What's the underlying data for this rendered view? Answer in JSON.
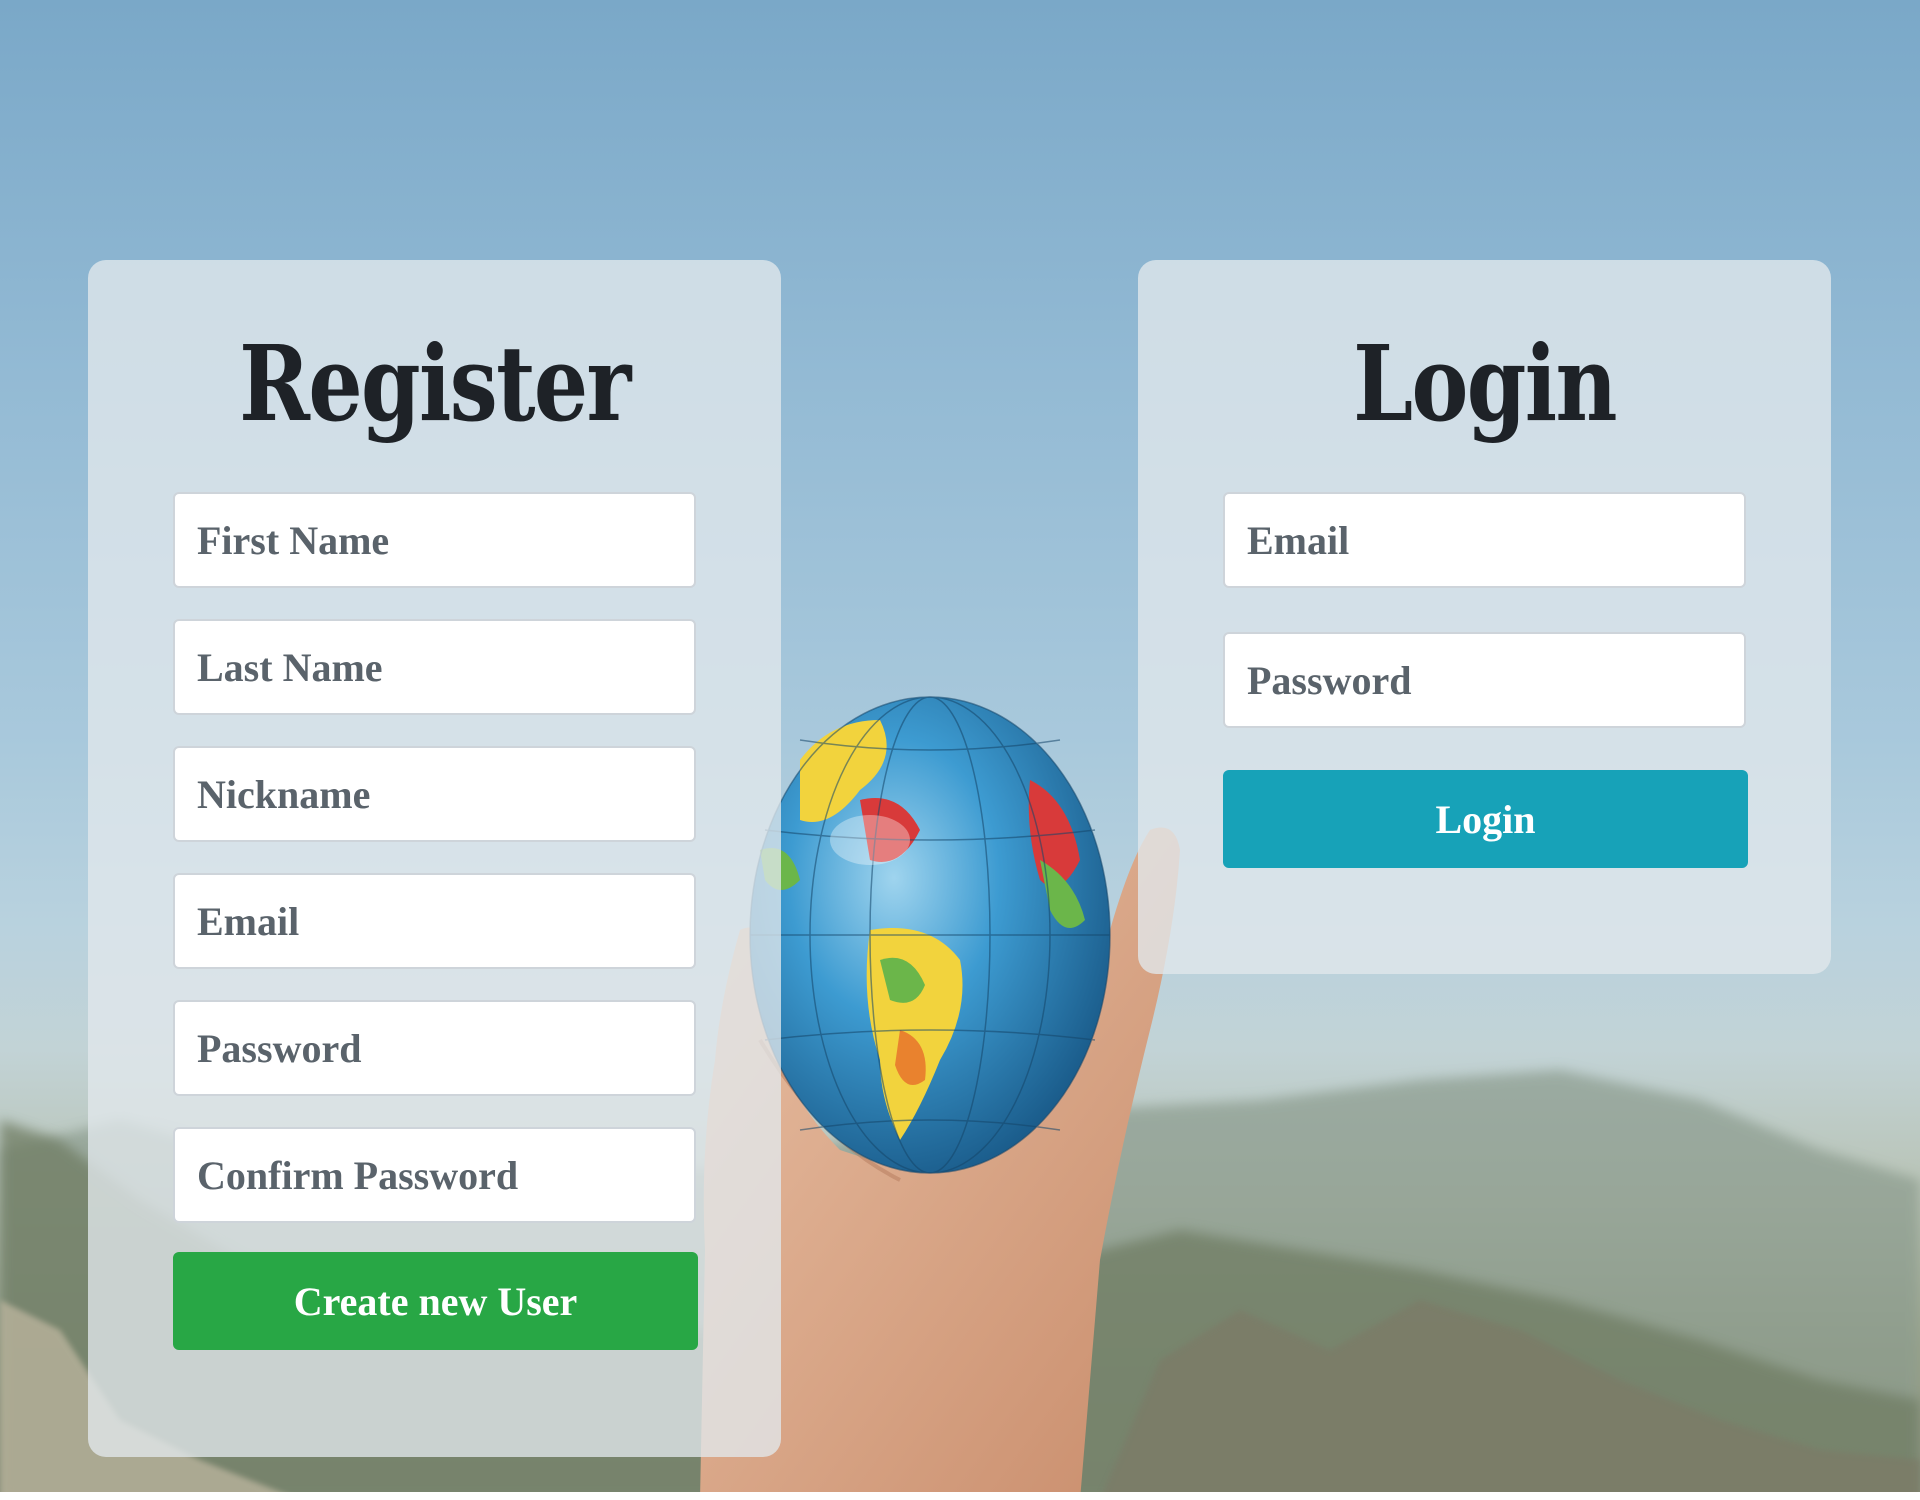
{
  "register": {
    "title": "Register",
    "fields": {
      "first_name": "First Name",
      "last_name": "Last Name",
      "nickname": "Nickname",
      "email": "Email",
      "password": "Password",
      "confirm_password": "Confirm Password"
    },
    "submit_label": "Create new User"
  },
  "login": {
    "title": "Login",
    "fields": {
      "email": "Email",
      "password": "Password"
    },
    "submit_label": "Login"
  },
  "colors": {
    "create_button": "#28a745",
    "login_button": "#17a2b8",
    "title_text": "#1e2227",
    "placeholder_text": "#5a636b"
  },
  "background": {
    "description_icon": "globe-in-hand-photo"
  }
}
